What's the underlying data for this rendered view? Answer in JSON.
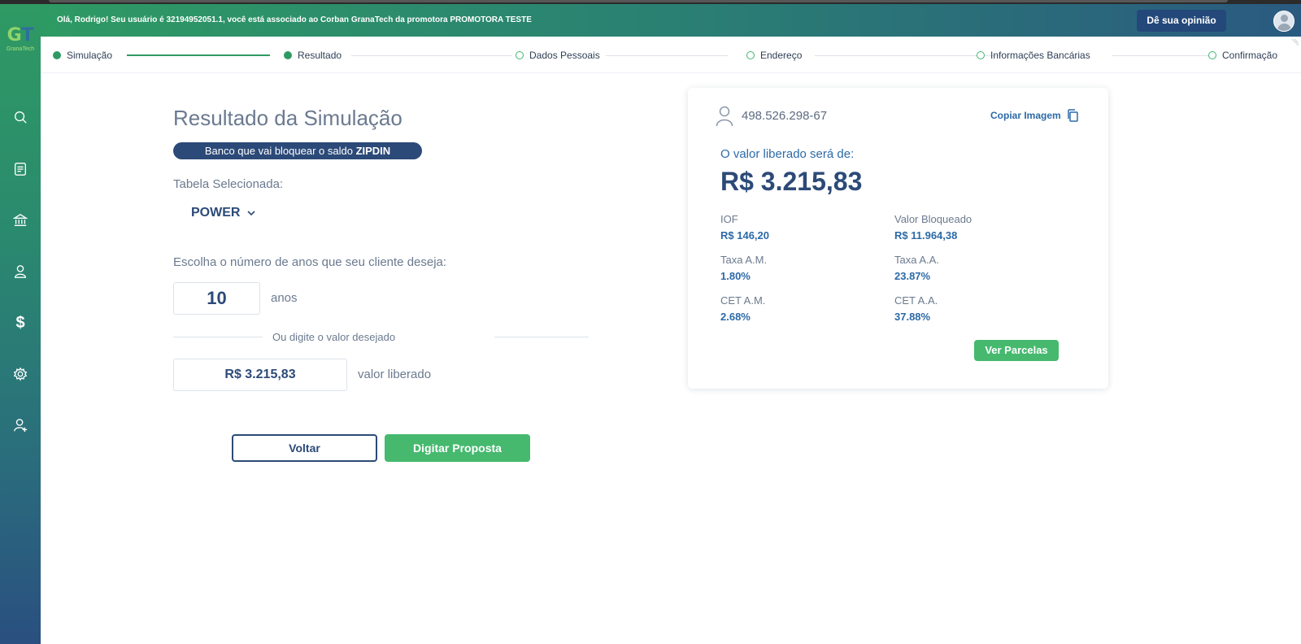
{
  "header": {
    "greeting": "Olá, Rodrigo! Seu usuário é 32194952051.1, você está associado ao Corban GranaTech da promotora PROMOTORA TESTE",
    "feedback_label": "Dê sua opinião"
  },
  "logo": {
    "brand": "GranaTech"
  },
  "sidebar": {
    "items": [
      {
        "icon": "search-icon"
      },
      {
        "icon": "document-icon"
      },
      {
        "icon": "bank-icon"
      },
      {
        "icon": "user-icon"
      },
      {
        "icon": "dollar-icon",
        "glyph": "$"
      },
      {
        "icon": "gear-icon"
      },
      {
        "icon": "user-add-icon"
      }
    ]
  },
  "stepper": {
    "steps": [
      {
        "label": "Simulação",
        "status": "done"
      },
      {
        "label": "Resultado",
        "status": "done"
      },
      {
        "label": "Dados Pessoais",
        "status": "todo"
      },
      {
        "label": "Endereço",
        "status": "todo"
      },
      {
        "label": "Informações Bancárias",
        "status": "todo"
      },
      {
        "label": "Confirmação",
        "status": "todo"
      }
    ]
  },
  "simulation": {
    "title": "Resultado da Simulação",
    "bank_badge_prefix": "Banco que vai bloquear o saldo ",
    "bank_name": "ZIPDIN",
    "table_label": "Tabela Selecionada:",
    "table_value": "POWER",
    "years_label": "Escolha o número de anos que seu cliente deseja:",
    "years_value": "10",
    "years_suffix": "anos",
    "or_text": "Ou digite o valor desejado",
    "value": "R$ 3.215,83",
    "value_suffix": "valor liberado",
    "back_label": "Voltar",
    "submit_label": "Digitar Proposta"
  },
  "result": {
    "cpf": "498.526.298-67",
    "copy_label": "Copiar Imagem",
    "released_label": "O valor liberado será de:",
    "released_value": "R$ 3.215,83",
    "details": [
      {
        "key": "IOF",
        "value": "R$ 146,20"
      },
      {
        "key": "Valor Bloqueado",
        "value": "R$ 11.964,38"
      },
      {
        "key": "Taxa A.M.",
        "value": "1.80%"
      },
      {
        "key": "Taxa A.A.",
        "value": "23.87%"
      },
      {
        "key": "CET A.M.",
        "value": "2.68%"
      },
      {
        "key": "CET A.A.",
        "value": "37.88%"
      }
    ],
    "installments_label": "Ver Parcelas"
  },
  "colors": {
    "brand_green": "#46b96f",
    "brand_navy": "#2c4a78",
    "accent_blue": "#2c6aa8"
  }
}
